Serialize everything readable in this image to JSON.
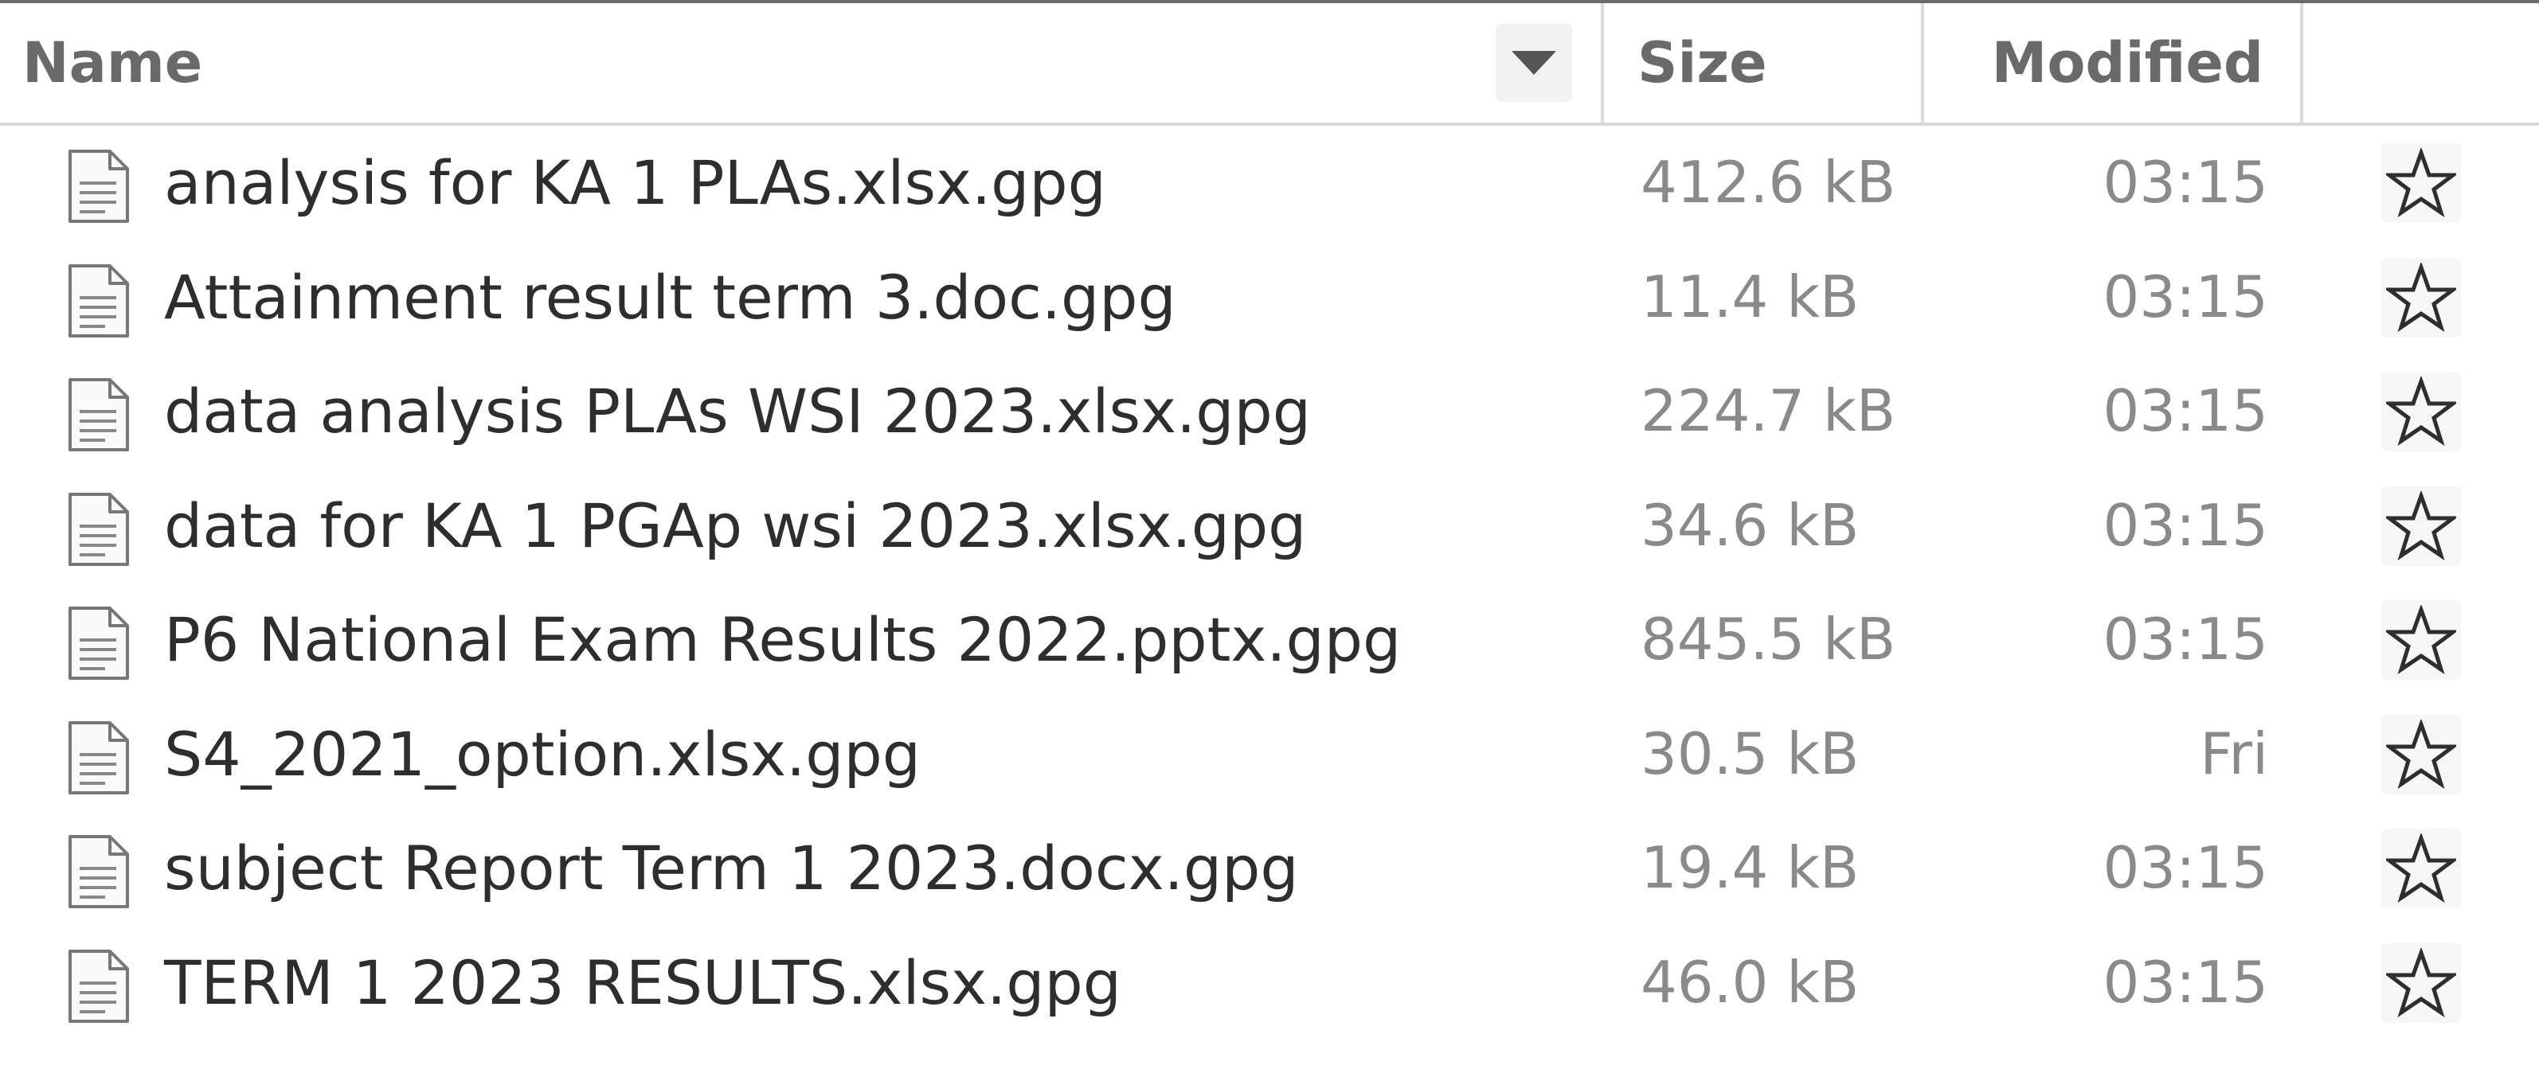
{
  "columns": {
    "name": "Name",
    "size": "Size",
    "modified": "Modified"
  },
  "sort_icon": "chevron-down-icon",
  "files": [
    {
      "name": "analysis for KA 1 PLAs.xlsx.gpg",
      "size": "412.6 kB",
      "modified": "03:15",
      "icon": "text-file-icon",
      "star": "star-outline-icon"
    },
    {
      "name": "Attainment result term 3.doc.gpg",
      "size": "11.4 kB",
      "modified": "03:15",
      "icon": "text-file-icon",
      "star": "star-outline-icon"
    },
    {
      "name": "data analysis PLAs WSI 2023.xlsx.gpg",
      "size": "224.7 kB",
      "modified": "03:15",
      "icon": "text-file-icon",
      "star": "star-outline-icon"
    },
    {
      "name": "data for KA 1 PGAp wsi 2023.xlsx.gpg",
      "size": "34.6 kB",
      "modified": "03:15",
      "icon": "text-file-icon",
      "star": "star-outline-icon"
    },
    {
      "name": "P6 National Exam Results 2022.pptx.gpg",
      "size": "845.5 kB",
      "modified": "03:15",
      "icon": "text-file-icon",
      "star": "star-outline-icon"
    },
    {
      "name": "S4_2021_option.xlsx.gpg",
      "size": "30.5 kB",
      "modified": "Fri",
      "icon": "text-file-icon",
      "star": "star-outline-icon"
    },
    {
      "name": "subject Report Term 1 2023.docx.gpg",
      "size": "19.4 kB",
      "modified": "03:15",
      "icon": "text-file-icon",
      "star": "star-outline-icon"
    },
    {
      "name": "TERM 1 2023 RESULTS.xlsx.gpg",
      "size": "46.0 kB",
      "modified": "03:15",
      "icon": "text-file-icon",
      "star": "star-outline-icon"
    }
  ]
}
